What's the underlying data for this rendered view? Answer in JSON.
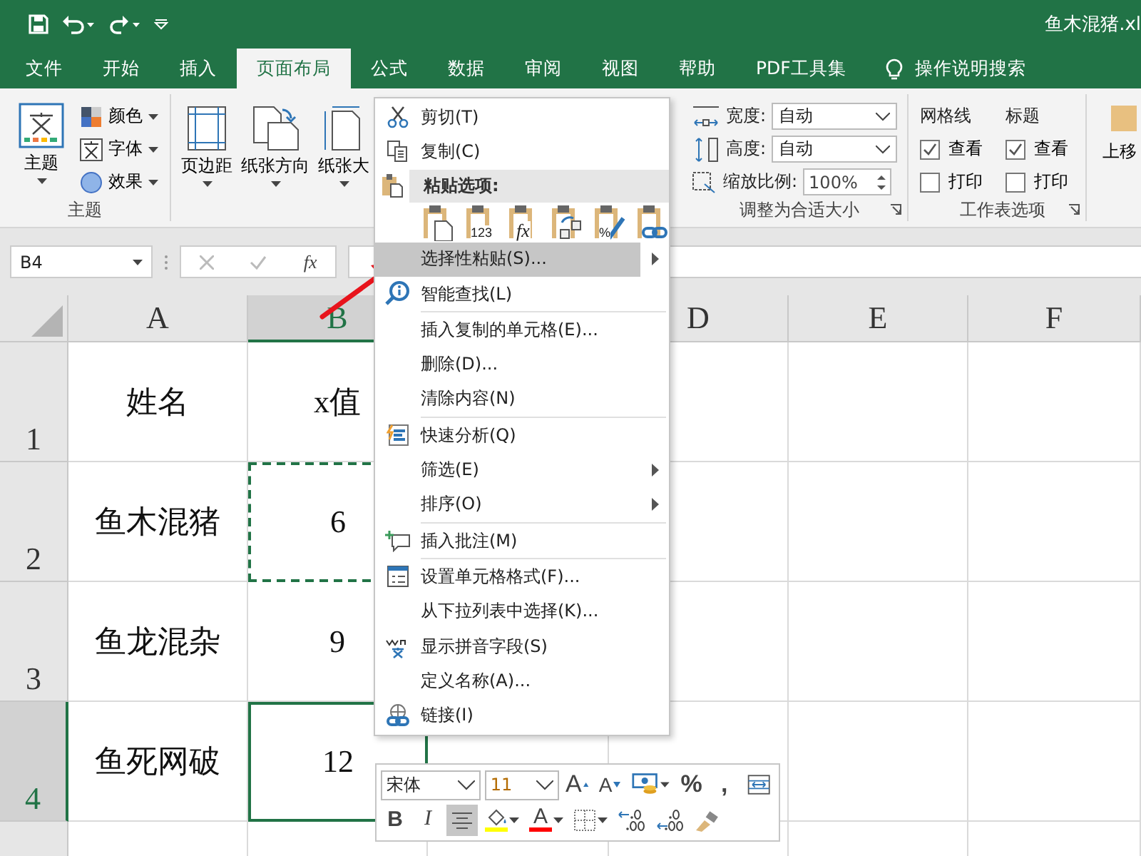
{
  "title_bar": {
    "file_name": "鱼木混猪.xl"
  },
  "tabs": [
    {
      "label": "文件",
      "selected": false
    },
    {
      "label": "开始",
      "selected": false
    },
    {
      "label": "插入",
      "selected": false
    },
    {
      "label": "页面布局",
      "selected": true
    },
    {
      "label": "公式",
      "selected": false
    },
    {
      "label": "数据",
      "selected": false
    },
    {
      "label": "审阅",
      "selected": false
    },
    {
      "label": "视图",
      "selected": false
    },
    {
      "label": "帮助",
      "selected": false
    },
    {
      "label": "PDF工具集",
      "selected": false
    }
  ],
  "tell_me": {
    "label": "操作说明搜索"
  },
  "ribbon": {
    "themes": {
      "big_button": "主题",
      "small_buttons": [
        "颜色",
        "字体",
        "效果"
      ],
      "group_label": "主题"
    },
    "page_setup": {
      "buttons": [
        "页边距",
        "纸张方向",
        "纸张大"
      ]
    },
    "scale": {
      "width_label": "宽度:",
      "width_value": "自动",
      "height_label": "高度:",
      "height_value": "自动",
      "scale_label": "缩放比例:",
      "scale_value": "100%",
      "group_label": "调整为合适大小"
    },
    "sheet_options": {
      "columns": [
        {
          "title": "网格线",
          "view": {
            "label": "查看",
            "checked": true
          },
          "print": {
            "label": "打印",
            "checked": false
          }
        },
        {
          "title": "标题",
          "view": {
            "label": "查看",
            "checked": true
          },
          "print": {
            "label": "打印",
            "checked": false
          }
        }
      ],
      "group_label": "工作表选项"
    },
    "arrange": {
      "button": "上移"
    }
  },
  "formula_bar": {
    "name_box": "B4",
    "fx_label": "fx"
  },
  "sheet": {
    "columns": [
      {
        "label": "A",
        "selected": false
      },
      {
        "label": "B",
        "selected": true
      },
      {
        "label": "D",
        "selected": false,
        "hidden_before": true
      },
      {
        "label": "E",
        "selected": false
      },
      {
        "label": "F",
        "selected": false
      }
    ],
    "rows": [
      {
        "label": "1",
        "selected": false,
        "cells": [
          {
            "text": "姓名"
          },
          {
            "text": "x值"
          }
        ]
      },
      {
        "label": "2",
        "selected": false,
        "cells": [
          {
            "text": "鱼木混猪"
          },
          {
            "text": "6",
            "copied": true
          }
        ]
      },
      {
        "label": "3",
        "selected": false,
        "cells": [
          {
            "text": "鱼龙混杂"
          },
          {
            "text": "9"
          }
        ]
      },
      {
        "label": "4",
        "selected": true,
        "cells": [
          {
            "text": "鱼死网破"
          },
          {
            "text": "12",
            "selected": true
          }
        ]
      }
    ]
  },
  "context_menu": [
    {
      "kind": "item",
      "label": "剪切(T)",
      "selected": false,
      "submenu": false
    },
    {
      "kind": "item",
      "label": "复制(C)",
      "selected": false,
      "submenu": false
    },
    {
      "kind": "header",
      "label": "粘贴选项:"
    },
    {
      "kind": "paste_options",
      "options": [
        {
          "kind": "paste"
        },
        {
          "kind": "values",
          "label": "123"
        },
        {
          "kind": "formulas",
          "label": "fx"
        },
        {
          "kind": "transpose"
        },
        {
          "kind": "formatting",
          "label": "%"
        },
        {
          "kind": "link"
        }
      ]
    },
    {
      "kind": "item",
      "label": "选择性粘贴(S)...",
      "selected": true,
      "submenu": true
    },
    {
      "kind": "item",
      "label": "智能查找(L)",
      "selected": false,
      "submenu": false
    },
    {
      "kind": "separator"
    },
    {
      "kind": "item",
      "label": "插入复制的单元格(E)...",
      "selected": false,
      "submenu": false
    },
    {
      "kind": "item",
      "label": "删除(D)...",
      "selected": false,
      "submenu": false
    },
    {
      "kind": "item",
      "label": "清除内容(N)",
      "selected": false,
      "submenu": false
    },
    {
      "kind": "separator"
    },
    {
      "kind": "item",
      "label": "快速分析(Q)",
      "selected": false,
      "submenu": false
    },
    {
      "kind": "item",
      "label": "筛选(E)",
      "selected": false,
      "submenu": true
    },
    {
      "kind": "item",
      "label": "排序(O)",
      "selected": false,
      "submenu": true
    },
    {
      "kind": "separator"
    },
    {
      "kind": "item",
      "label": "插入批注(M)",
      "selected": false,
      "submenu": false
    },
    {
      "kind": "separator"
    },
    {
      "kind": "item",
      "label": "设置单元格格式(F)...",
      "selected": false,
      "submenu": false
    },
    {
      "kind": "item",
      "label": "从下拉列表中选择(K)...",
      "selected": false,
      "submenu": false
    },
    {
      "kind": "item",
      "label": "显示拼音字段(S)",
      "selected": false,
      "submenu": false
    },
    {
      "kind": "item",
      "label": "定义名称(A)...",
      "selected": false,
      "submenu": false
    },
    {
      "kind": "item",
      "label": "链接(I)",
      "selected": false,
      "submenu": false
    }
  ],
  "mini_toolbar": {
    "font": "宋体",
    "size": "11",
    "row1": [
      {
        "kind": "grow",
        "label": "A"
      },
      {
        "kind": "shrink",
        "label": "A"
      },
      {
        "kind": "accounting"
      },
      {
        "kind": "percent",
        "label": "%"
      },
      {
        "kind": "comma",
        "label": ","
      },
      {
        "kind": "wrap"
      }
    ],
    "row2": [
      {
        "kind": "bold",
        "label": "B",
        "selected": false
      },
      {
        "kind": "italic",
        "label": "I",
        "selected": false
      },
      {
        "kind": "center",
        "selected": true
      },
      {
        "kind": "fill",
        "color": "#ffff00"
      },
      {
        "kind": "font_color",
        "label": "A",
        "color": "#ff0000"
      },
      {
        "kind": "borders"
      },
      {
        "kind": "inc_decimal"
      },
      {
        "kind": "dec_decimal"
      },
      {
        "kind": "painter"
      }
    ]
  }
}
